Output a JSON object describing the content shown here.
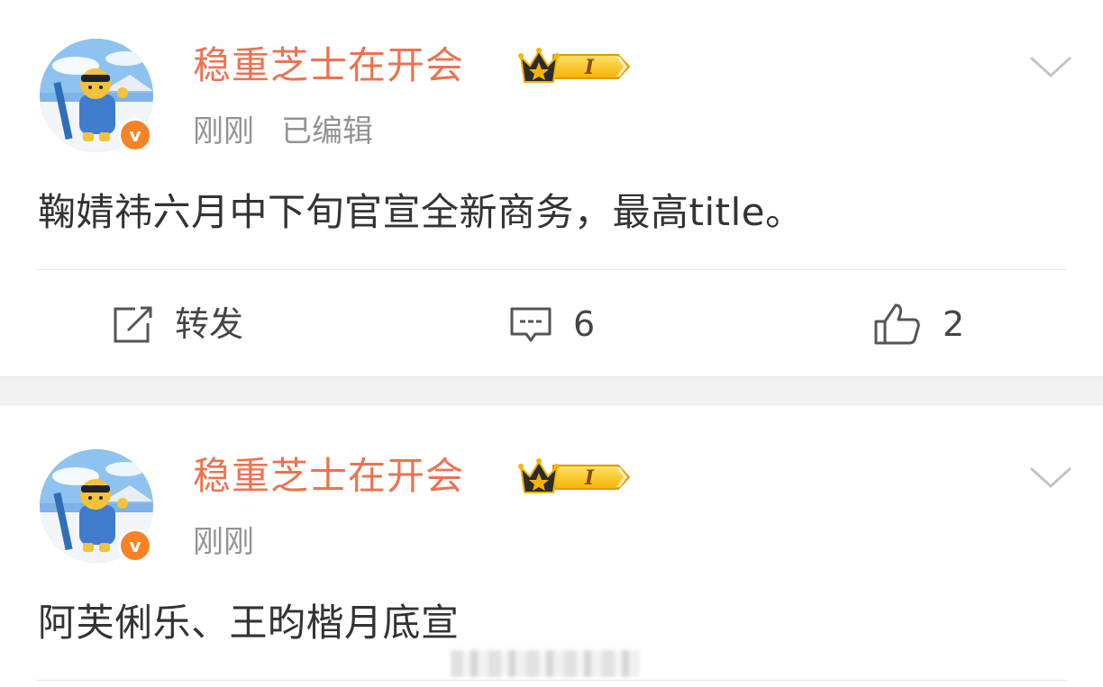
{
  "posts": [
    {
      "username": "稳重芝士在开会",
      "vip_level": "I",
      "verified_mark": "v",
      "time": "刚刚",
      "edited": "已编辑",
      "content": "鞠婧祎六月中下旬官宣全新商务，最高title。",
      "actions": {
        "repost_label": "转发",
        "comment_count": "6",
        "like_count": "2"
      }
    },
    {
      "username": "稳重芝士在开会",
      "vip_level": "I",
      "verified_mark": "v",
      "time": "刚刚",
      "content": "阿芙俐乐、王昀楷月底宣"
    }
  ],
  "colors": {
    "username": "#eb7350",
    "meta": "#939393",
    "content": "#333333",
    "verified": "#f78224",
    "separator": "#f1f1f1"
  },
  "icons": [
    "avatar-image",
    "verified-v-icon",
    "vip-crown-icon",
    "chevron-down-icon",
    "repost-icon",
    "comment-icon",
    "like-icon"
  ]
}
